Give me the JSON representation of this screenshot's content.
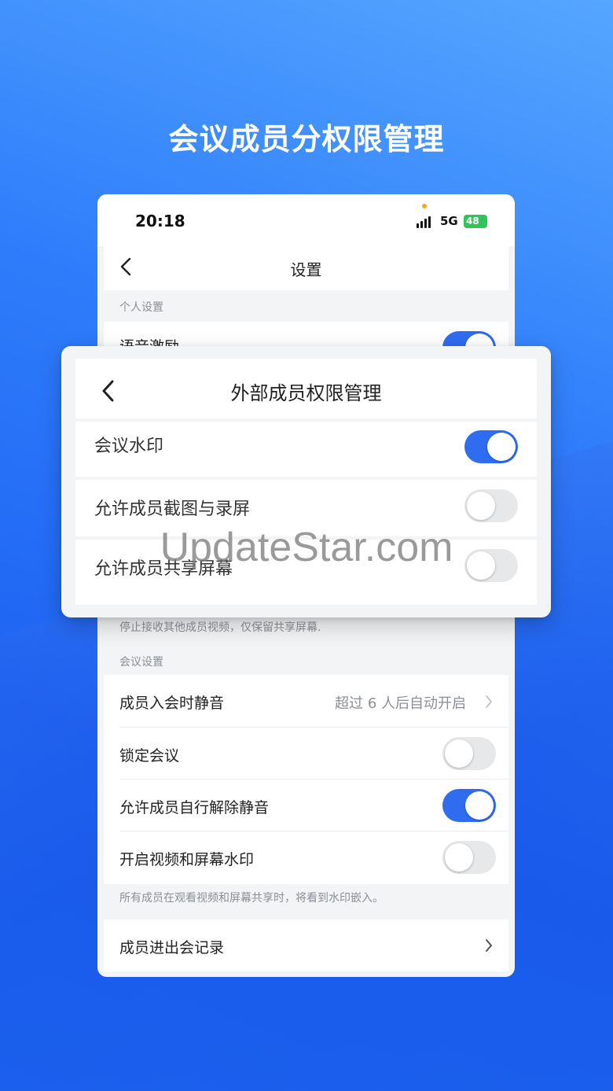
{
  "headline": "会议成员分权限管理",
  "watermark": "UpdateStar.com",
  "status_bar": {
    "time": "20:18",
    "network": "5G",
    "battery": "48"
  },
  "settings": {
    "title": "设置",
    "personal_section": "个人设置",
    "voice_excitation_label": "语音激励",
    "voice_excitation_on": true,
    "share_hint": "停止接收其他成员视频，仅保留共享屏幕.",
    "meeting_section": "会议设置",
    "rows": [
      {
        "label": "成员入会时静音",
        "value": "超过 6 人后自动开启"
      },
      {
        "label": "锁定会议",
        "toggle": false
      },
      {
        "label": "允许成员自行解除静音",
        "toggle": true
      },
      {
        "label": "开启视频和屏幕水印",
        "toggle": false
      }
    ],
    "watermark_hint": "所有成员在观看视频和屏幕共享时，将看到水印嵌入。",
    "log_row": "成员进出会记录"
  },
  "popup": {
    "title": "外部成员权限管理",
    "rows": [
      {
        "label": "会议水印",
        "toggle": true
      },
      {
        "label": "允许成员截图与录屏",
        "toggle": false
      },
      {
        "label": "允许成员共享屏幕",
        "toggle": false
      }
    ]
  },
  "colors": {
    "accent": "#2f6cf0",
    "toggle_off": "#e7e8ea",
    "battery": "#32c35a"
  }
}
